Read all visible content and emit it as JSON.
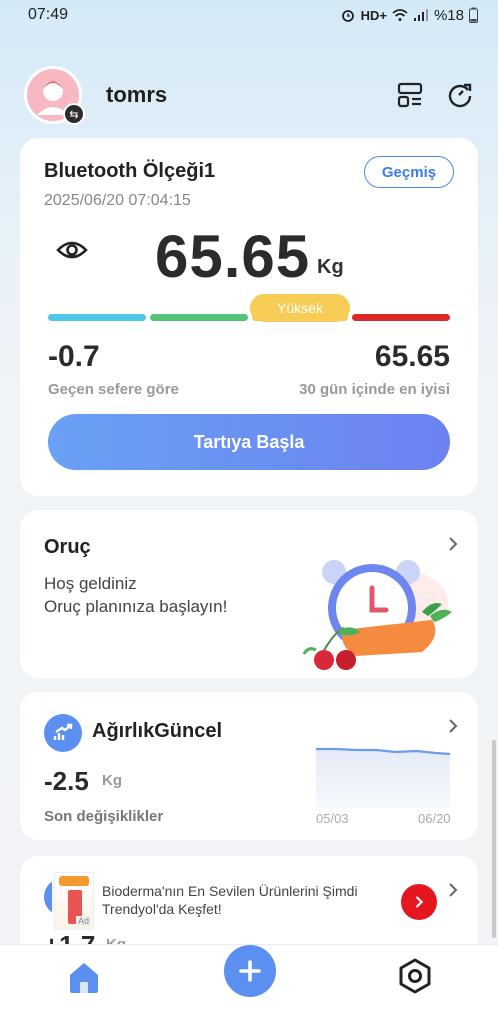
{
  "status_bar": {
    "time": "07:49",
    "network": "HD+",
    "battery": "%18"
  },
  "header": {
    "username": "tomrs"
  },
  "scale_card": {
    "device_name": "Bluetooth Ölçeği1",
    "history_label": "Geçmiş",
    "timestamp": "2025/06/20 07:04:15",
    "weight": "65.65",
    "unit": "Kg",
    "status_label": "Yüksek",
    "change_value": "-0.7",
    "change_label": "Geçen sefere göre",
    "best_value": "65.65",
    "best_label": "30 gün içinde en iyisi",
    "start_button": "Tartıya Başla",
    "colors": {
      "bar1": "#4ec8e8",
      "bar2": "#52c57a",
      "bar3": "#f5cd52",
      "bar4": "#dd2828"
    }
  },
  "fasting_card": {
    "title": "Oruç",
    "line1": "Hoş geldiniz",
    "line2": "Oruç planınıza başlayın!"
  },
  "trend_card": {
    "title": "AğırlıkGüncel",
    "change_value": "-2.5",
    "unit": "Kg",
    "label": "Son değişiklikler",
    "x_start": "05/03",
    "x_end": "06/20"
  },
  "next_card": {
    "value": "+1.7",
    "unit": "Kg"
  },
  "ad": {
    "text": "Bioderma'nın En Sevilen Ürünlerini Şimdi Trendyol'da Keşfet!",
    "tag": "Ad"
  },
  "icons": {
    "avatar": "person-avatar-icon",
    "switch": "switch-user-icon",
    "layout": "layout-icon",
    "refresh": "refresh-icon",
    "eye": "eye-icon",
    "chevron": "chevron-right-icon",
    "trend": "trend-up-icon",
    "home": "home-icon",
    "add": "add-icon",
    "settings": "settings-icon"
  }
}
